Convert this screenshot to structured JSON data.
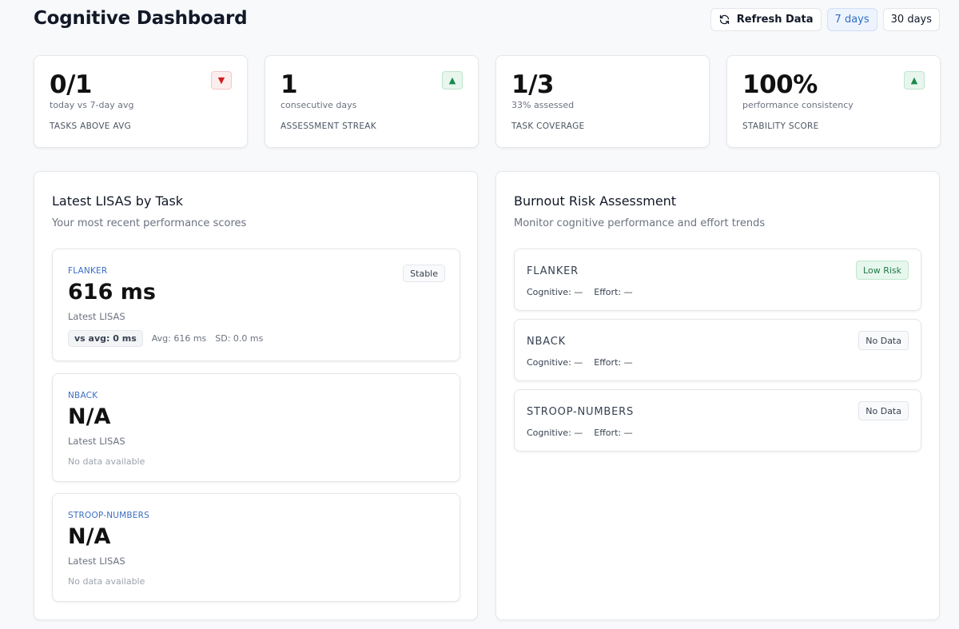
{
  "header": {
    "title": "Cognitive Dashboard",
    "refresh_label": "Refresh Data",
    "refresh_icon": "refresh-icon",
    "ranges": [
      {
        "label": "7 days",
        "active": true
      },
      {
        "label": "30 days",
        "active": false
      }
    ]
  },
  "kpis": [
    {
      "value": "0/1",
      "sub": "today vs 7-day avg",
      "label": "TASKS ABOVE AVG",
      "trend": "down",
      "trend_symbol": "▼"
    },
    {
      "value": "1",
      "sub": "consecutive days",
      "label": "ASSESSMENT STREAK",
      "trend": "up",
      "trend_symbol": "▲"
    },
    {
      "value": "1/3",
      "sub": "33% assessed",
      "label": "TASK COVERAGE",
      "trend": null,
      "trend_symbol": null
    },
    {
      "value": "100%",
      "sub": "performance consistency",
      "label": "STABILITY SCORE",
      "trend": "up",
      "trend_symbol": "▲"
    }
  ],
  "lisas_panel": {
    "title": "Latest LISAS by Task",
    "subtitle": "Your most recent performance scores",
    "tasks": [
      {
        "name": "FLANKER",
        "value": "616 ms",
        "caption": "Latest LISAS",
        "badge": "Stable",
        "vs_avg": "vs avg: 0 ms",
        "avg": "Avg: 616 ms",
        "sd": "SD: 0.0 ms"
      },
      {
        "name": "NBACK",
        "value": "N/A",
        "caption": "Latest LISAS",
        "nodata": "No data available"
      },
      {
        "name": "STROOP-NUMBERS",
        "value": "N/A",
        "caption": "Latest LISAS",
        "nodata": "No data available"
      }
    ]
  },
  "burnout_panel": {
    "title": "Burnout Risk Assessment",
    "subtitle": "Monitor cognitive performance and effort trends",
    "items": [
      {
        "name": "FLANKER",
        "cognitive": "Cognitive: —",
        "effort": "Effort: —",
        "badge": "Low Risk",
        "risk": "low"
      },
      {
        "name": "NBACK",
        "cognitive": "Cognitive: —",
        "effort": "Effort: —",
        "badge": "No Data",
        "risk": "none"
      },
      {
        "name": "STROOP-NUMBERS",
        "cognitive": "Cognitive: —",
        "effort": "Effort: —",
        "badge": "No Data",
        "risk": "none"
      }
    ]
  },
  "colors": {
    "accent": "#2f6dc8",
    "task_name": "#3b6fc4",
    "risk_low": "#1d7a45",
    "trend_down": "#d11f1f",
    "trend_up": "#178a4a"
  }
}
